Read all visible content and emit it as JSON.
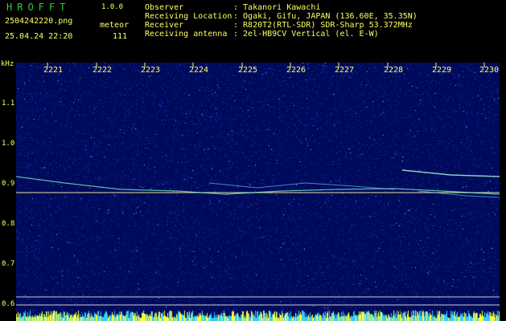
{
  "app": {
    "title": "HROFFT",
    "version": "1.0.0"
  },
  "file": {
    "name": "2504242220.png",
    "kind": "meteor",
    "timestamp": "25.04.24 22:20",
    "count": "111"
  },
  "meta": [
    {
      "label": "Observer",
      "value": ": Takanori Kawachi"
    },
    {
      "label": "Receiving Location",
      "value": ": Ogaki, Gifu, JAPAN (136.60E, 35.35N)"
    },
    {
      "label": "Receiver",
      "value": ": R820T2(RTL-SDR) SDR-Sharp 53.372MHz"
    },
    {
      "label": "Receiving antenna",
      "value": ": 2el-HB9CV Vertical (el. E-W)"
    }
  ],
  "axis": {
    "unit": "kHz",
    "y_ticks": [
      "1.1",
      "1.0",
      "0.9",
      "0.8",
      "0.7",
      "0.6"
    ],
    "x_ticks": [
      "2221",
      "2222",
      "2223",
      "2224",
      "2225",
      "2226",
      "2227",
      "2228",
      "2229",
      "2230"
    ]
  },
  "colors": {
    "background": "#000a5a",
    "text": "#ffff66",
    "title": "#33cc33",
    "signal": "#ccffcc"
  }
}
